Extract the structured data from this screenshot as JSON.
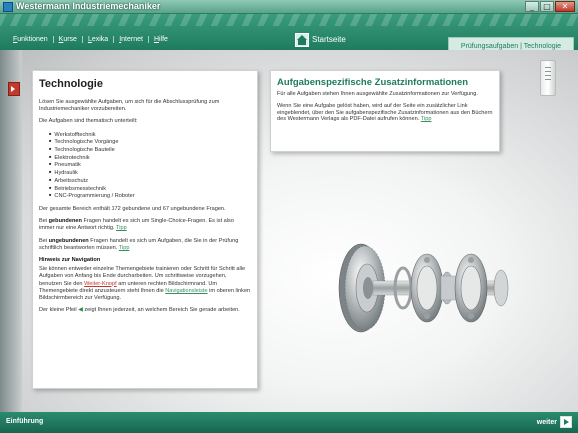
{
  "window": {
    "title": "Westermann Industriemechaniker"
  },
  "menu": {
    "items": [
      {
        "first": "F",
        "rest": "unktionen"
      },
      {
        "first": "K",
        "rest": "urse"
      },
      {
        "first": "L",
        "rest": "exika"
      },
      {
        "first": "I",
        "rest": "nternet"
      },
      {
        "first": "H",
        "rest": "ilfe"
      }
    ]
  },
  "header": {
    "startseite": "Startseite",
    "breadcrumb": "Prüfungsaufgaben | Technologie"
  },
  "left_panel": {
    "title": "Technologie",
    "intro": "Lösen Sie ausgewählte Aufgaben, um sich für die Abschlussprüfung zum Industriemechaniker vorzubereiten.",
    "list_intro": "Die Aufgaben sind thematisch unterteilt:",
    "topics": [
      "Werkstofftechnik",
      "Technologische Vorgänge",
      "Technologische Bauteile",
      "Elektrotechnik",
      "Pneumatik",
      "Hydraulik",
      "Arbeitsschutz",
      "Betriebsmesstechnik",
      "CNC-Programmierung / Roboter"
    ],
    "total": "Der gesamte Bereich enthält 172 gebundene und 67 ungebundene Fragen.",
    "bound": {
      "pre": "Bei ",
      "bold": "gebundenen",
      "post": " Fragen handelt es sich um Single-Choice-Fragen. Es ist also immer nur eine Antwort richtig. ",
      "link": "Tipp"
    },
    "unbound": {
      "pre": "Bei ",
      "bold": "ungebundenen",
      "post": " Fragen handelt es sich um Aufgaben, die Sie in der Prüfung schriftlich beantworten müssen. ",
      "link": "Tipp"
    },
    "nav_heading": "Hinweis zur Navigation",
    "nav_text1": "Sie können entweder einzelne Themengebiete trainieren oder Schritt für Schritt alle Aufgaben von Anfang bis Ende durcharbeiten. Um schrittweise vorzugehen, benutzen Sie den ",
    "nav_link1": "Weiter-Knopf",
    "nav_text2": " am unteren rechten Bildschirmrand. Um Themengebiete direkt anzusteuern steht Ihnen die ",
    "nav_link2": "Navigationsleiste",
    "nav_text3": " im oberen linken Bildschirmbereich zur Verfügung.",
    "arrow_pre": "Der kleine Pfeil ",
    "arrow_post": " zeigt Ihnen jederzeit, an welchem Bereich Sie gerade arbeiten."
  },
  "right_panel": {
    "title": "Aufgabenspezifische Zusatzinformationen",
    "p1": "Für alle Aufgaben stehen Ihnen ausgewählte Zusatzinformationen zur Verfügung.",
    "p2": "Wenn Sie eine Aufgabe gelöst haben, wird auf der Seite ein zusätzlicher Link eingeblendet, über den Sie aufgabenspezifische Zusatzinformationen aus den Büchern des Westermann Verlags als PDF-Datei aufrufen können. ",
    "p2_link": "Tipp"
  },
  "footer": {
    "left": "Einführung",
    "right": "weiter"
  }
}
